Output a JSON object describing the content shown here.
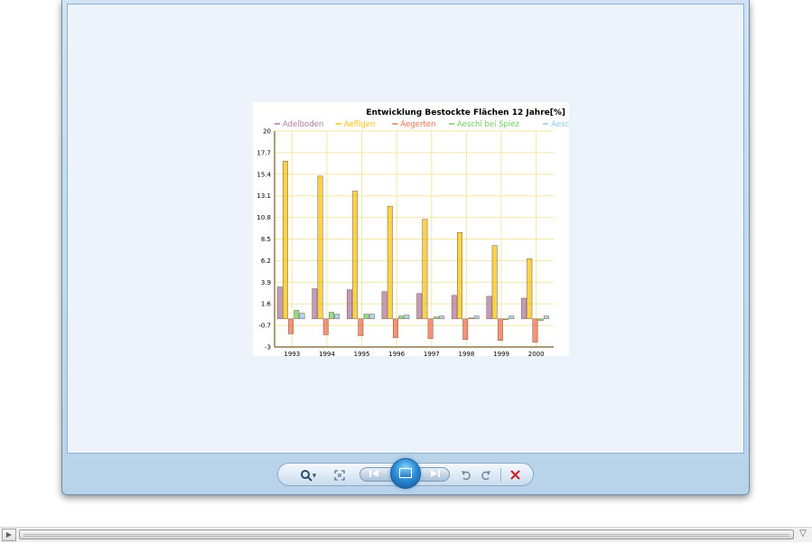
{
  "toolbar": {
    "zoom_icon": "magnifier-icon",
    "zoom_dropdown": "▾",
    "fit_icon": "fit-to-window-icon",
    "prev_icon": "previous-icon",
    "next_icon": "next-icon",
    "rotate_ccw_icon": "rotate-counterclockwise-icon",
    "rotate_cw_icon": "rotate-clockwise-icon",
    "delete_icon": "delete-icon",
    "slideshow_icon": "slideshow-icon"
  },
  "scrollbar": {
    "left_arrow": "▶",
    "right_arrow": "▽"
  },
  "chart_data": {
    "type": "bar",
    "title": "Entwicklung Bestockte Flächen 12 Jahre[%]",
    "categories": [
      "1993",
      "1994",
      "1995",
      "1996",
      "1997",
      "1998",
      "1999",
      "2000"
    ],
    "series": [
      {
        "name": "Adelboden",
        "color": "#b07aa1",
        "values": [
          3.4,
          3.2,
          3.1,
          2.9,
          2.7,
          2.5,
          2.4,
          2.2
        ]
      },
      {
        "name": "Aefligen",
        "color": "#f5c40f",
        "values": [
          16.8,
          15.2,
          13.6,
          12.0,
          10.6,
          9.2,
          7.8,
          6.4
        ]
      },
      {
        "name": "Aegerten",
        "color": "#f07050",
        "values": [
          -1.6,
          -1.7,
          -1.8,
          -2.0,
          -2.1,
          -2.2,
          -2.3,
          -2.5
        ]
      },
      {
        "name": "Aeschi bei Spiez",
        "color": "#6fcf5f",
        "values": [
          0.9,
          0.7,
          0.5,
          0.3,
          0.2,
          0.1,
          -0.1,
          -0.2
        ]
      },
      {
        "name": "Aeschlen",
        "color": "#8ec7e6",
        "values": [
          0.6,
          0.5,
          0.5,
          0.4,
          0.3,
          0.3,
          0.3,
          0.3
        ]
      }
    ],
    "y_ticks": [
      "20",
      "17.7",
      "15.4",
      "13.1",
      "10.8",
      "8.5",
      "6.2",
      "3.9",
      "1.6",
      "-0.7",
      "-3"
    ],
    "ylim": [
      -3,
      20
    ],
    "grid": true,
    "legend": "top"
  }
}
